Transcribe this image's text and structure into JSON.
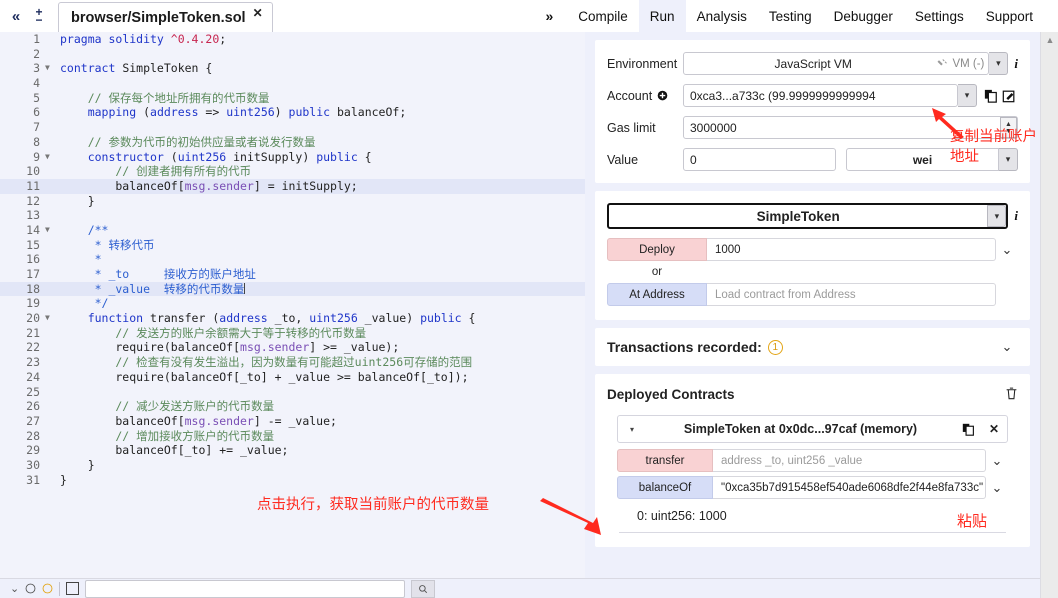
{
  "topbar": {
    "collapse_icon": "«",
    "fontsize_increase": "+",
    "fontsize_decrease": "−",
    "tab_label": "browser/SimpleToken.sol",
    "tab_close": "✕",
    "expand_chevron": "»",
    "menu": [
      {
        "label": "Compile",
        "active": false
      },
      {
        "label": "Run",
        "active": true
      },
      {
        "label": "Analysis",
        "active": false
      },
      {
        "label": "Testing",
        "active": false
      },
      {
        "label": "Debugger",
        "active": false
      },
      {
        "label": "Settings",
        "active": false
      },
      {
        "label": "Support",
        "active": false
      }
    ]
  },
  "editor": {
    "lines": [
      {
        "n": "1",
        "fold": false,
        "hl": false,
        "tokens": [
          {
            "t": "pragma ",
            "c": "kw"
          },
          {
            "t": "solidity ",
            "c": "kw"
          },
          {
            "t": "^0.4.20",
            "c": "num"
          },
          {
            "t": ";",
            "c": "id"
          }
        ]
      },
      {
        "n": "2",
        "fold": false,
        "hl": false,
        "tokens": []
      },
      {
        "n": "3",
        "fold": true,
        "hl": false,
        "tokens": [
          {
            "t": "contract ",
            "c": "kw"
          },
          {
            "t": "SimpleToken {",
            "c": "id"
          }
        ]
      },
      {
        "n": "4",
        "fold": false,
        "hl": false,
        "tokens": []
      },
      {
        "n": "5",
        "fold": false,
        "hl": false,
        "tokens": [
          {
            "t": "    // 保存每个地址所拥有的代币数量",
            "c": "cmt"
          }
        ]
      },
      {
        "n": "6",
        "fold": false,
        "hl": false,
        "tokens": [
          {
            "t": "    mapping ",
            "c": "kw"
          },
          {
            "t": "(",
            "c": "id"
          },
          {
            "t": "address",
            "c": "kw"
          },
          {
            "t": " => ",
            "c": "id"
          },
          {
            "t": "uint256",
            "c": "kw"
          },
          {
            "t": ") ",
            "c": "id"
          },
          {
            "t": "public",
            "c": "kw"
          },
          {
            "t": " balanceOf;",
            "c": "id"
          }
        ]
      },
      {
        "n": "7",
        "fold": false,
        "hl": false,
        "tokens": []
      },
      {
        "n": "8",
        "fold": false,
        "hl": false,
        "tokens": [
          {
            "t": "    // 参数为代币的初始供应量或者说发行数量",
            "c": "cmt"
          }
        ]
      },
      {
        "n": "9",
        "fold": true,
        "hl": false,
        "tokens": [
          {
            "t": "    constructor ",
            "c": "kw"
          },
          {
            "t": "(",
            "c": "id"
          },
          {
            "t": "uint256",
            "c": "kw"
          },
          {
            "t": " initSupply) ",
            "c": "id"
          },
          {
            "t": "public",
            "c": "kw"
          },
          {
            "t": " {",
            "c": "id"
          }
        ]
      },
      {
        "n": "10",
        "fold": false,
        "hl": false,
        "tokens": [
          {
            "t": "        // 创建者拥有所有的代币",
            "c": "cmt"
          }
        ]
      },
      {
        "n": "11",
        "fold": false,
        "hl": true,
        "tokens": [
          {
            "t": "        balanceOf[",
            "c": "id"
          },
          {
            "t": "msg.sender",
            "c": "prop"
          },
          {
            "t": "] = initSupply;",
            "c": "id"
          }
        ]
      },
      {
        "n": "12",
        "fold": false,
        "hl": false,
        "tokens": [
          {
            "t": "    }",
            "c": "id"
          }
        ]
      },
      {
        "n": "13",
        "fold": false,
        "hl": false,
        "tokens": []
      },
      {
        "n": "14",
        "fold": true,
        "hl": false,
        "tokens": [
          {
            "t": "    /**",
            "c": "cmt-blue"
          }
        ]
      },
      {
        "n": "15",
        "fold": false,
        "hl": false,
        "tokens": [
          {
            "t": "     * 转移代币",
            "c": "cmt-blue"
          }
        ]
      },
      {
        "n": "16",
        "fold": false,
        "hl": false,
        "tokens": [
          {
            "t": "     *",
            "c": "cmt-blue"
          }
        ]
      },
      {
        "n": "17",
        "fold": false,
        "hl": false,
        "tokens": [
          {
            "t": "     * _to     接收方的账户地址",
            "c": "cmt-blue"
          }
        ]
      },
      {
        "n": "18",
        "fold": false,
        "hl": true,
        "tokens": [
          {
            "t": "     * _value  转移的代币数量",
            "c": "cmt-blue"
          },
          {
            "t": "|",
            "c": "caret"
          }
        ]
      },
      {
        "n": "19",
        "fold": false,
        "hl": false,
        "tokens": [
          {
            "t": "     */",
            "c": "cmt-blue"
          }
        ]
      },
      {
        "n": "20",
        "fold": true,
        "hl": false,
        "tokens": [
          {
            "t": "    function ",
            "c": "kw"
          },
          {
            "t": "transfer ",
            "c": "id"
          },
          {
            "t": "(",
            "c": "id"
          },
          {
            "t": "address",
            "c": "kw"
          },
          {
            "t": " _to, ",
            "c": "id"
          },
          {
            "t": "uint256",
            "c": "kw"
          },
          {
            "t": " _value) ",
            "c": "id"
          },
          {
            "t": "public",
            "c": "kw"
          },
          {
            "t": " {",
            "c": "id"
          }
        ]
      },
      {
        "n": "21",
        "fold": false,
        "hl": false,
        "tokens": [
          {
            "t": "        // 发送方的账户余额需大于等于转移的代币数量",
            "c": "cmt"
          }
        ]
      },
      {
        "n": "22",
        "fold": false,
        "hl": false,
        "tokens": [
          {
            "t": "        require(balanceOf[",
            "c": "id"
          },
          {
            "t": "msg.sender",
            "c": "prop"
          },
          {
            "t": "] >= _value);",
            "c": "id"
          }
        ]
      },
      {
        "n": "23",
        "fold": false,
        "hl": false,
        "tokens": [
          {
            "t": "        // 检查有没有发生溢出，因为数量有可能超过uint256可存储的范围",
            "c": "cmt"
          }
        ]
      },
      {
        "n": "24",
        "fold": false,
        "hl": false,
        "tokens": [
          {
            "t": "        require(balanceOf[_to] + _value >= balanceOf[_to]);",
            "c": "id"
          }
        ]
      },
      {
        "n": "25",
        "fold": false,
        "hl": false,
        "tokens": []
      },
      {
        "n": "26",
        "fold": false,
        "hl": false,
        "tokens": [
          {
            "t": "        // 减少发送方账户的代币数量",
            "c": "cmt"
          }
        ]
      },
      {
        "n": "27",
        "fold": false,
        "hl": false,
        "tokens": [
          {
            "t": "        balanceOf[",
            "c": "id"
          },
          {
            "t": "msg.sender",
            "c": "prop"
          },
          {
            "t": "] -= _value;",
            "c": "id"
          }
        ]
      },
      {
        "n": "28",
        "fold": false,
        "hl": false,
        "tokens": [
          {
            "t": "        // 增加接收方账户的代币数量",
            "c": "cmt"
          }
        ]
      },
      {
        "n": "29",
        "fold": false,
        "hl": false,
        "tokens": [
          {
            "t": "        balanceOf[_to] += _value;",
            "c": "id"
          }
        ]
      },
      {
        "n": "30",
        "fold": false,
        "hl": false,
        "tokens": [
          {
            "t": "    }",
            "c": "id"
          }
        ]
      },
      {
        "n": "31",
        "fold": false,
        "hl": false,
        "tokens": [
          {
            "t": "}",
            "c": "id"
          }
        ]
      }
    ]
  },
  "run_panel": {
    "environment": {
      "label": "Environment",
      "value": "JavaScript VM",
      "vm_status": "VM (-)",
      "plug_icon": "plug-icon",
      "info_icon": "i"
    },
    "account": {
      "label": "Account",
      "plus_icon": "+",
      "value": "0xca3...a733c (99.9999999999994",
      "copy_icon": "copy-icon",
      "edit_icon": "edit-icon"
    },
    "gas_limit": {
      "label": "Gas limit",
      "value": "3000000"
    },
    "value": {
      "label": "Value",
      "value": "0",
      "unit": "wei"
    },
    "contract": {
      "selected": "SimpleToken",
      "info_icon": "i",
      "deploy_label": "Deploy",
      "deploy_arg": "1000",
      "or_label": "or",
      "at_address_label": "At Address",
      "at_address_placeholder": "Load contract from Address"
    },
    "transactions": {
      "title": "Transactions recorded:",
      "count": "1"
    },
    "deployed": {
      "title": "Deployed Contracts",
      "trash_icon": "trash-icon",
      "instance": {
        "name": "SimpleToken at 0x0dc...97caf (memory)",
        "copy_icon": "copy-icon",
        "close_icon": "✕",
        "expand_icon": "▾"
      },
      "functions": [
        {
          "name": "transfer",
          "style": "pink",
          "arg_value": "",
          "arg_placeholder": "address _to, uint256 _value"
        },
        {
          "name": "balanceOf",
          "style": "blue",
          "arg_value": "\"0xca35b7d915458ef540ade6068dfe2f44e8fa733c\"",
          "arg_placeholder": ""
        }
      ],
      "result": "0: uint256: 1000"
    }
  },
  "annotations": {
    "copy_account": "复制当前账户\n地址",
    "click_execute": "点击执行，获取当前账户的代币数量",
    "paste": "粘贴",
    "color": "#ff2a1f"
  },
  "colors": {
    "panel_bg": "#eef0fb",
    "editor_bg": "#f2f3fb",
    "card_bg": "#ffffff",
    "pink_button": "#f9d2d3",
    "blue_button": "#d6ddf7",
    "badge_orange": "#d89a0e"
  }
}
